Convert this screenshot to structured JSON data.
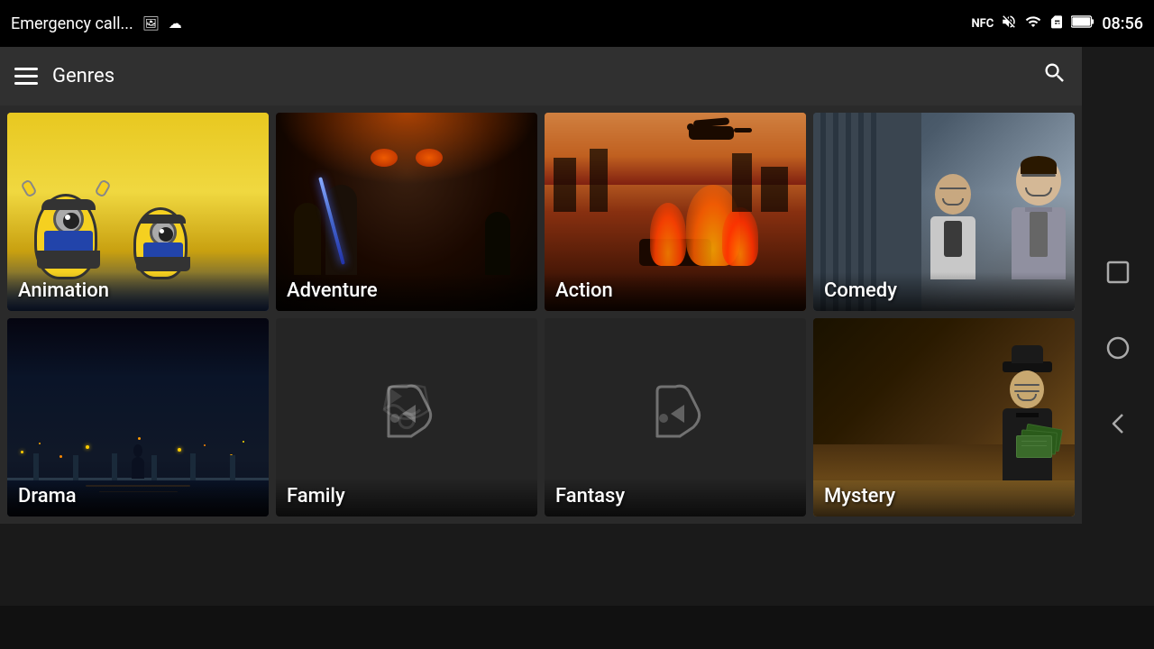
{
  "statusBar": {
    "appName": "Emergency call...",
    "time": "08:56",
    "icons": {
      "nfc": "NFC",
      "mute": "🔇",
      "wifi": "📶",
      "sim": "📱",
      "battery": "🔋"
    }
  },
  "appBar": {
    "title": "Genres",
    "menuIcon": "menu",
    "searchIcon": "search"
  },
  "genres": [
    {
      "id": "animation",
      "label": "Animation",
      "hasImage": true,
      "colorClass": "card-animation"
    },
    {
      "id": "adventure",
      "label": "Adventure",
      "hasImage": true,
      "colorClass": "card-adventure"
    },
    {
      "id": "action",
      "label": "Action",
      "hasImage": true,
      "colorClass": "card-action"
    },
    {
      "id": "comedy",
      "label": "Comedy",
      "hasImage": true,
      "colorClass": "card-comedy"
    },
    {
      "id": "drama",
      "label": "Drama",
      "hasImage": true,
      "colorClass": "card-drama"
    },
    {
      "id": "family",
      "label": "Family",
      "hasImage": false,
      "colorClass": "card-family"
    },
    {
      "id": "fantasy",
      "label": "Fantasy",
      "hasImage": false,
      "colorClass": "card-fantasy"
    },
    {
      "id": "mystery",
      "label": "Mystery",
      "hasImage": true,
      "colorClass": "card-mystery"
    }
  ],
  "navButtons": {
    "square": "⬜",
    "circle": "⭕",
    "back": "◁"
  }
}
